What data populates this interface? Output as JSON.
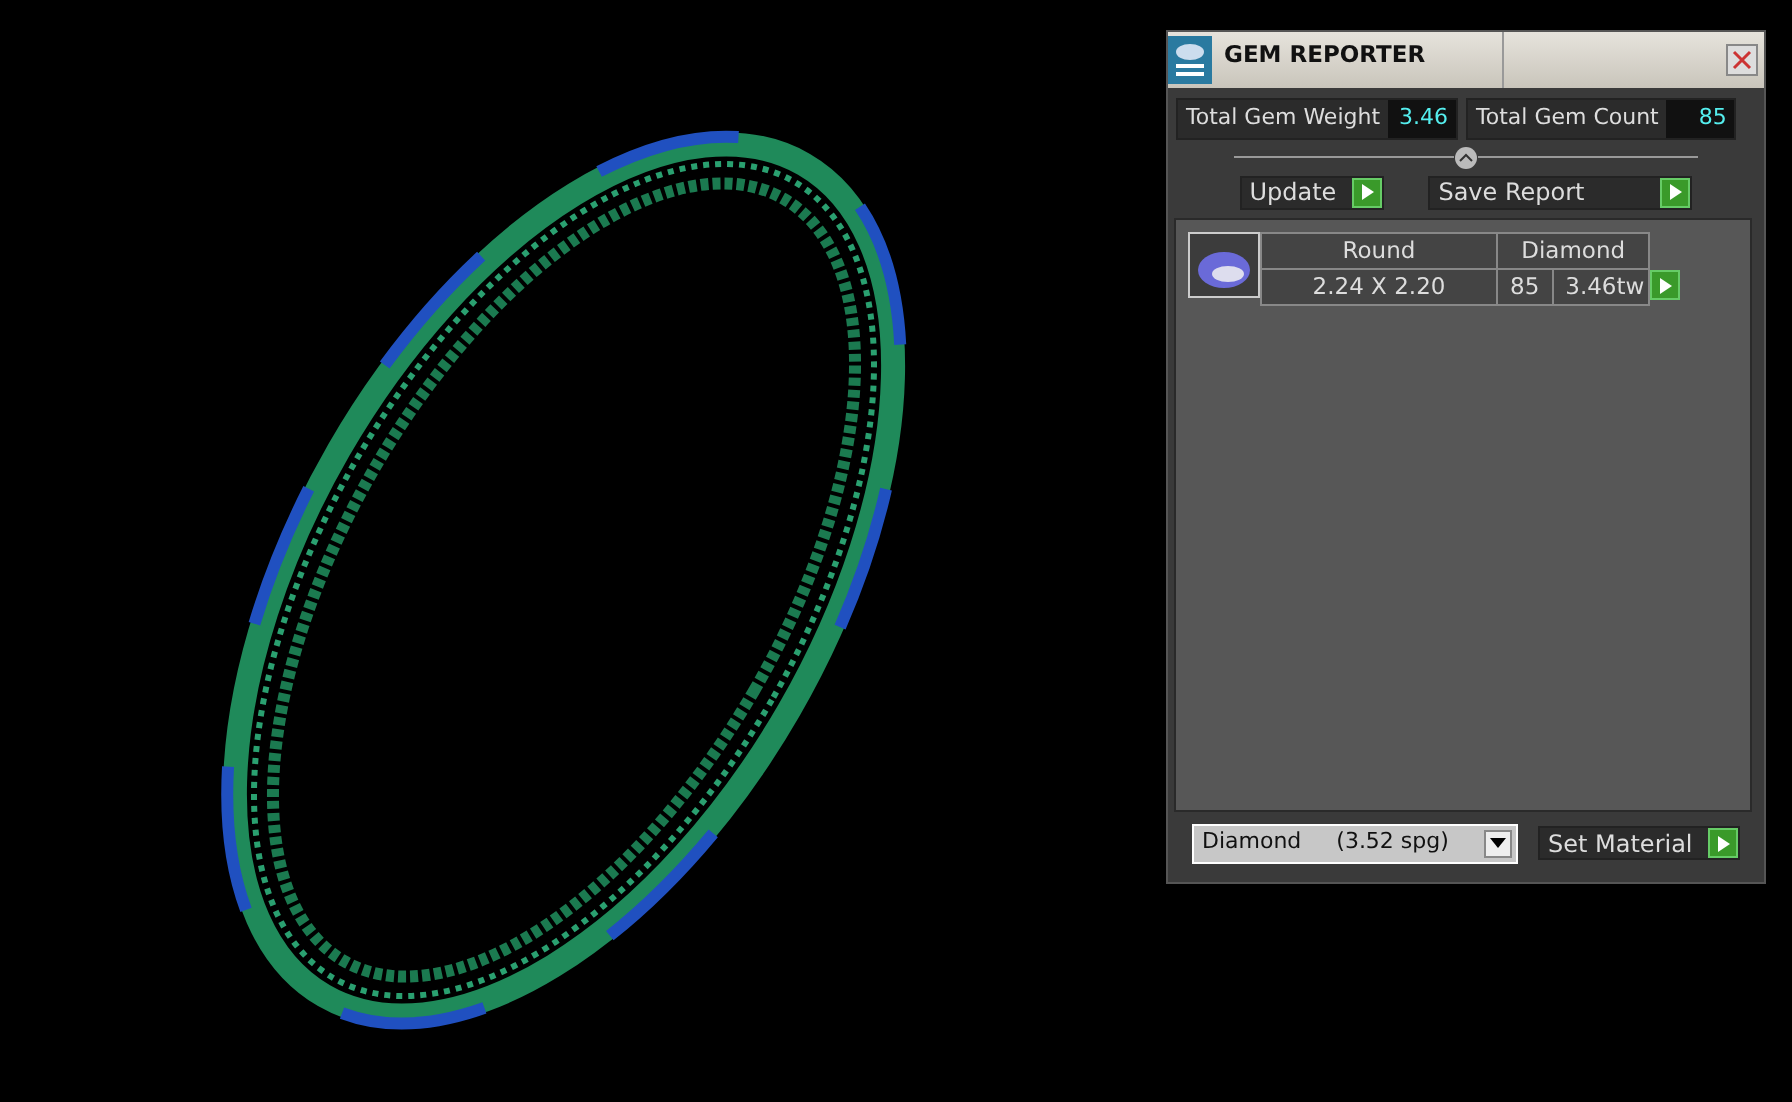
{
  "window": {
    "title": "GEM REPORTER"
  },
  "totals": [
    {
      "label": "Total Gem Weight",
      "value": "3.46"
    },
    {
      "label": "Total Gem Count",
      "value": "85"
    }
  ],
  "buttons": [
    "Update",
    "Save Report"
  ],
  "gems": [
    {
      "shape": "Round",
      "material": "Diamond",
      "size": "2.24 X 2.20",
      "count": "85",
      "weight": "3.46tw"
    }
  ],
  "material_select": {
    "value": "Diamond     (3.52 spg)"
  },
  "set_material_button": "Set Material"
}
